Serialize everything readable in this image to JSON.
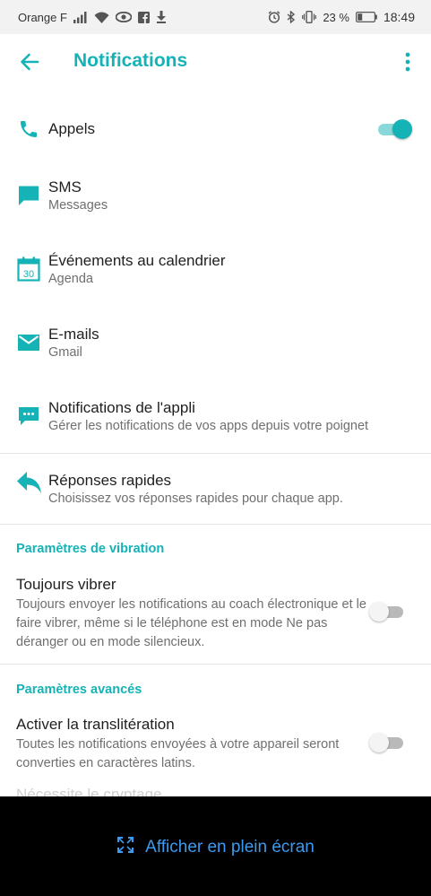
{
  "status_bar": {
    "carrier": "Orange F",
    "battery_text": "23 %",
    "time": "18:49",
    "icons": [
      "signal-icon",
      "wifi-icon",
      "eye-icon",
      "facebook-icon",
      "download-icon",
      "alarm-icon",
      "bluetooth-icon",
      "vibrate-icon",
      "battery-icon"
    ]
  },
  "app_bar": {
    "title": "Notifications",
    "back_icon": "back-arrow-icon",
    "menu_icon": "more-vert-icon"
  },
  "notifications": [
    {
      "icon": "phone-icon",
      "title": "Appels",
      "subtitle": "",
      "toggle": true
    },
    {
      "icon": "sms-icon",
      "title": "SMS",
      "subtitle": "Messages"
    },
    {
      "icon": "calendar-icon",
      "icon_text": "30",
      "title": "Événements au calendrier",
      "subtitle": "Agenda"
    },
    {
      "icon": "email-icon",
      "title": "E-mails",
      "subtitle": "Gmail"
    },
    {
      "icon": "app-notification-icon",
      "title": "Notifications de l'appli",
      "subtitle": "Gérer les notifications de vos apps depuis votre poignet"
    },
    {
      "icon": "reply-icon",
      "title": "Réponses rapides",
      "subtitle": "Choisissez vos réponses rapides pour chaque app."
    }
  ],
  "vibration_section": {
    "header": "Paramètres de vibration",
    "title": "Toujours vibrer",
    "description": "Toujours envoyer les notifications au coach électronique et le faire vibrer, même si le téléphone est en mode Ne pas déranger ou en mode silencieux.",
    "toggle": false
  },
  "advanced_section": {
    "header": "Paramètres avancés",
    "title": "Activer la translitération",
    "description": "Toutes les notifications envoyées à votre appareil seront converties en caractères latins.",
    "toggle": false,
    "partial_next": "Nécessite le cryptage"
  },
  "bottom_bar": {
    "label": "Afficher en plein écran",
    "icon": "fullscreen-icon"
  },
  "colors": {
    "accent": "#16b3b6",
    "accent_light": "#8ad8da",
    "bottom_link": "#3b9bf0"
  }
}
